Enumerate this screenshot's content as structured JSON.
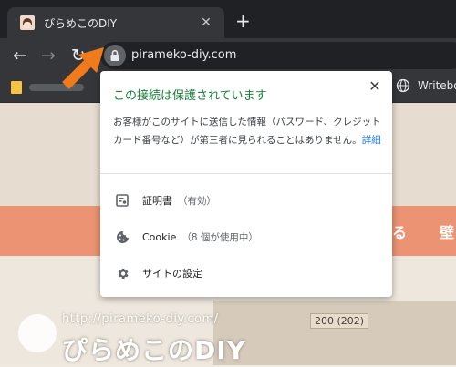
{
  "tab": {
    "title": "ぴらめこのDIY",
    "close_glyph": "✕"
  },
  "new_tab_glyph": "+",
  "toolbar": {
    "back_glyph": "←",
    "forward_glyph": "→",
    "reload_glyph": "↻"
  },
  "address_bar": {
    "url": "pirameko-diy.com"
  },
  "bookmarks_bar": {
    "right_item": "Writebo"
  },
  "page": {
    "nav_items": [
      "る",
      "壁"
    ],
    "watermark_url": "http://pirameko-diy.com/",
    "watermark_brand": "ぴらめこのDIY",
    "photo_label": "200 (202)"
  },
  "site_info_popup": {
    "title": "この接続は保護されています",
    "description": "お客様がこのサイトに送信した情報（パスワード、クレジット カード番号など）が第三者に見られることはありません。",
    "details_link": "詳細",
    "close_glyph": "✕",
    "items": [
      {
        "label": "証明書",
        "sub": "（有効）",
        "icon": "certificate-icon"
      },
      {
        "label": "Cookie",
        "sub": "（8 個が使用中）",
        "icon": "cookie-icon"
      },
      {
        "label": "サイトの設定",
        "sub": "",
        "icon": "gear-icon"
      }
    ]
  },
  "colors": {
    "secure_green": "#188038",
    "link_blue": "#1a73e8",
    "annotation_arrow": "#f07b1d",
    "site_nav_bar": "#eb9373"
  }
}
